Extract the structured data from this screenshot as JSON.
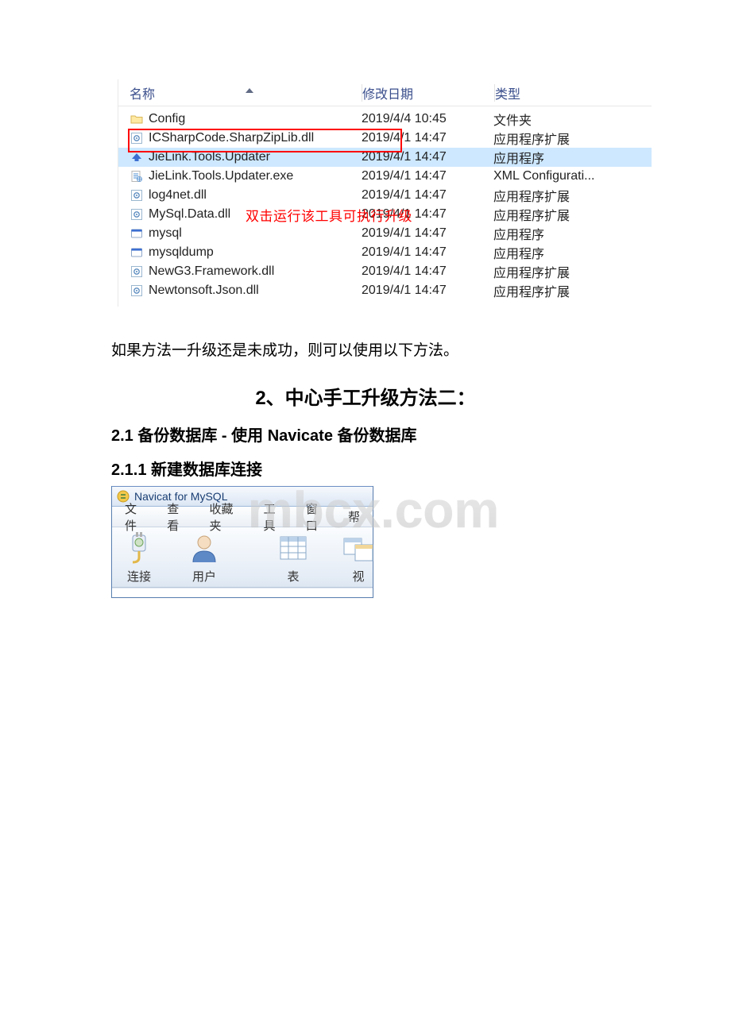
{
  "explorer": {
    "headers": {
      "name": "名称",
      "date": "修改日期",
      "type": "类型"
    },
    "rows": [
      {
        "icon": "folder-icon",
        "name": "Config",
        "date": "2019/4/4 10:45",
        "type": "文件夹",
        "selected": false
      },
      {
        "icon": "dll-icon",
        "name": "ICSharpCode.SharpZipLib.dll",
        "date": "2019/4/1 14:47",
        "type": "应用程序扩展",
        "selected": false
      },
      {
        "icon": "updater-icon",
        "name": "JieLink.Tools.Updater",
        "date": "2019/4/1 14:47",
        "type": "应用程序",
        "selected": true
      },
      {
        "icon": "config-icon",
        "name": "JieLink.Tools.Updater.exe",
        "date": "2019/4/1 14:47",
        "type": "XML Configurati...",
        "selected": false
      },
      {
        "icon": "dll-icon",
        "name": "log4net.dll",
        "date": "2019/4/1 14:47",
        "type": "应用程序扩展",
        "selected": false
      },
      {
        "icon": "dll-icon",
        "name": "MySql.Data.dll",
        "date": "2019/4/1 14:47",
        "type": "应用程序扩展",
        "selected": false
      },
      {
        "icon": "exe-icon",
        "name": "mysql",
        "date": "2019/4/1 14:47",
        "type": "应用程序",
        "selected": false
      },
      {
        "icon": "exe-icon",
        "name": "mysqldump",
        "date": "2019/4/1 14:47",
        "type": "应用程序",
        "selected": false
      },
      {
        "icon": "dll-icon",
        "name": "NewG3.Framework.dll",
        "date": "2019/4/1 14:47",
        "type": "应用程序扩展",
        "selected": false
      },
      {
        "icon": "dll-icon",
        "name": "Newtonsoft.Json.dll",
        "date": "2019/4/1 14:47",
        "type": "应用程序扩展",
        "selected": false
      }
    ],
    "annotation": "双击运行该工具可执行升级"
  },
  "body": {
    "para1": "如果方法一升级还是未成功，则可以使用以下方法。",
    "h1": "2、中心手工升级方法二：",
    "h2a": "2.1 备份数据库 - 使用 Navicate 备份数据库",
    "h2b": "2.1.1 新建数据库连接"
  },
  "navicat": {
    "title": "Navicat for MySQL",
    "menu": [
      "文件",
      "查看",
      "收藏夹",
      "工具",
      "窗口",
      "帮"
    ],
    "toolbar": [
      {
        "icon": "plug-icon",
        "label": "连接"
      },
      {
        "icon": "user-icon",
        "label": "用户"
      },
      {
        "icon": "table-icon",
        "label": "表"
      },
      {
        "icon": "view-icon",
        "label": "视"
      }
    ]
  },
  "watermark": "mbcx.com"
}
